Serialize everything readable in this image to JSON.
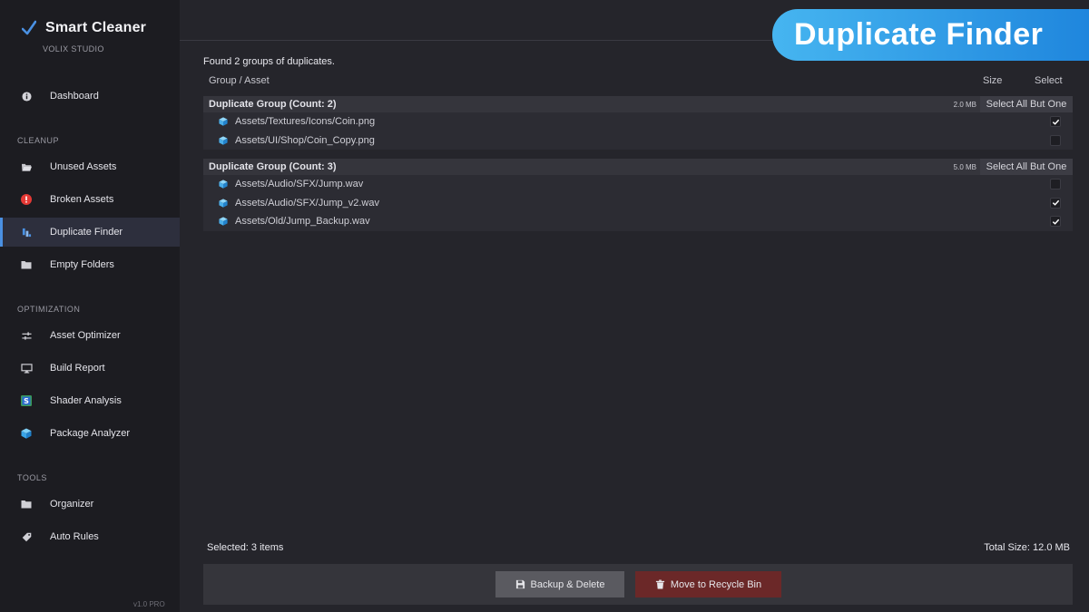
{
  "app": {
    "title": "Smart Cleaner",
    "subtitle": "VOLIX STUDIO",
    "version": "v1.0 PRO",
    "accent": "#4a90e2"
  },
  "banner": {
    "text": "Duplicate Finder"
  },
  "sidebar": {
    "dashboard": {
      "label": "Dashboard",
      "icon": "info-icon"
    },
    "sections": [
      {
        "label": "CLEANUP",
        "items": [
          {
            "label": "Unused Assets",
            "icon": "folder-open-icon"
          },
          {
            "label": "Broken Assets",
            "icon": "error-icon"
          },
          {
            "label": "Duplicate Finder",
            "icon": "duplicate-icon",
            "active": true
          },
          {
            "label": "Empty Folders",
            "icon": "folder-icon"
          }
        ]
      },
      {
        "label": "OPTIMIZATION",
        "items": [
          {
            "label": "Asset Optimizer",
            "icon": "sliders-icon"
          },
          {
            "label": "Build Report",
            "icon": "monitor-icon"
          },
          {
            "label": "Shader Analysis",
            "icon": "shader-icon"
          },
          {
            "label": "Package Analyzer",
            "icon": "cube-icon"
          }
        ]
      },
      {
        "label": "TOOLS",
        "items": [
          {
            "label": "Organizer",
            "icon": "folder-icon"
          },
          {
            "label": "Auto Rules",
            "icon": "tag-icon"
          }
        ]
      }
    ]
  },
  "main": {
    "found_text": "Found 2 groups of duplicates.",
    "columns": {
      "asset": "Group / Asset",
      "size": "Size",
      "select": "Select"
    },
    "groups": [
      {
        "title": "Duplicate Group (Count: 2)",
        "size": "2.0 MB",
        "select_button": "Select All But One",
        "assets": [
          {
            "path": "Assets/Textures/Icons/Coin.png",
            "checked": true
          },
          {
            "path": "Assets/UI/Shop/Coin_Copy.png",
            "checked": false
          }
        ]
      },
      {
        "title": "Duplicate Group (Count: 3)",
        "size": "5.0 MB",
        "select_button": "Select All But One",
        "assets": [
          {
            "path": "Assets/Audio/SFX/Jump.wav",
            "checked": false
          },
          {
            "path": "Assets/Audio/SFX/Jump_v2.wav",
            "checked": true
          },
          {
            "path": "Assets/Old/Jump_Backup.wav",
            "checked": true
          }
        ]
      }
    ],
    "footer": {
      "selected": "Selected: 3 items",
      "total": "Total Size: 12.0 MB"
    },
    "actions": {
      "backup_delete": "Backup & Delete",
      "recycle": "Move to Recycle Bin"
    }
  }
}
